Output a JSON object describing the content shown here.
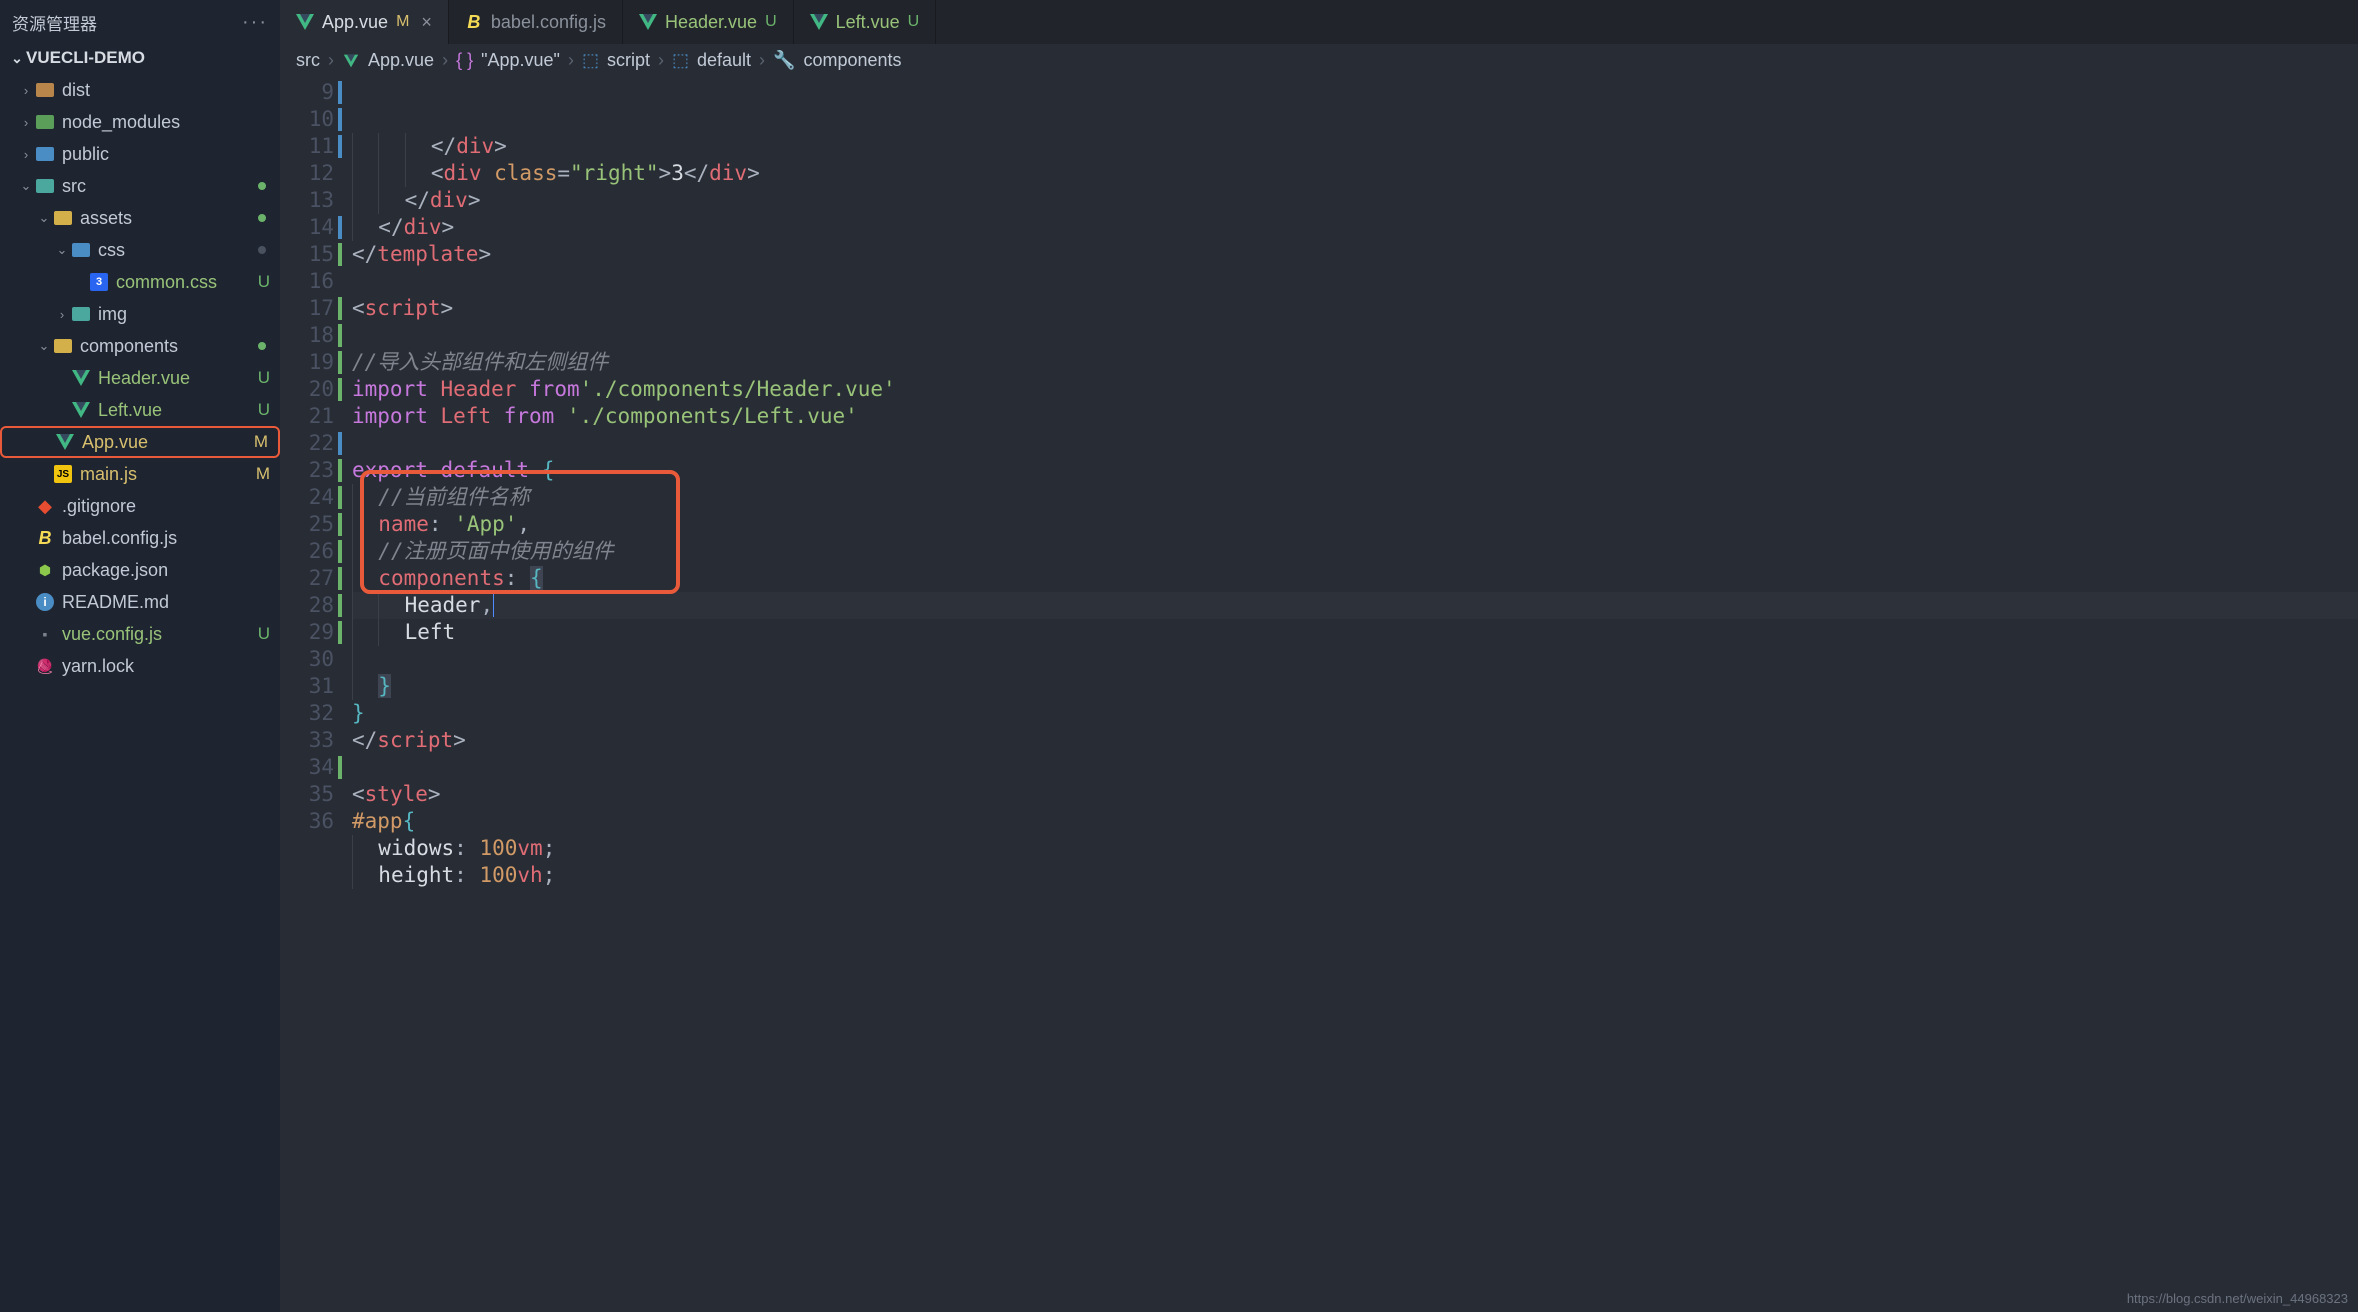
{
  "sidebar": {
    "title": "资源管理器",
    "project": "VUECLI-DEMO",
    "tree": [
      {
        "indent": 1,
        "chevron": "›",
        "icon": "folder",
        "label": "dist",
        "badge": ""
      },
      {
        "indent": 1,
        "chevron": "›",
        "icon": "folder-green",
        "label": "node_modules",
        "badge": ""
      },
      {
        "indent": 1,
        "chevron": "›",
        "icon": "folder-blue",
        "label": "public",
        "badge": ""
      },
      {
        "indent": 1,
        "chevron": "⌄",
        "icon": "folder-teal",
        "label": "src",
        "badge": "dot"
      },
      {
        "indent": 2,
        "chevron": "⌄",
        "icon": "folder-yellow",
        "label": "assets",
        "badge": "dot"
      },
      {
        "indent": 3,
        "chevron": "⌄",
        "icon": "folder-blue",
        "label": "css",
        "badge": "dot-dim"
      },
      {
        "indent": 4,
        "chevron": "",
        "icon": "css",
        "label": "common.css",
        "badge": "U"
      },
      {
        "indent": 3,
        "chevron": "›",
        "icon": "folder-teal",
        "label": "img",
        "badge": ""
      },
      {
        "indent": 2,
        "chevron": "⌄",
        "icon": "folder-yellow",
        "label": "components",
        "badge": "dot"
      },
      {
        "indent": 3,
        "chevron": "",
        "icon": "vue",
        "label": "Header.vue",
        "badge": "U"
      },
      {
        "indent": 3,
        "chevron": "",
        "icon": "vue",
        "label": "Left.vue",
        "badge": "U"
      },
      {
        "indent": 2,
        "chevron": "",
        "icon": "vue",
        "label": "App.vue",
        "badge": "M",
        "highlighted": true
      },
      {
        "indent": 2,
        "chevron": "",
        "icon": "js",
        "label": "main.js",
        "badge": "M"
      },
      {
        "indent": 1,
        "chevron": "",
        "icon": "git",
        "label": ".gitignore",
        "badge": ""
      },
      {
        "indent": 1,
        "chevron": "",
        "icon": "babel",
        "label": "babel.config.js",
        "badge": ""
      },
      {
        "indent": 1,
        "chevron": "",
        "icon": "node",
        "label": "package.json",
        "badge": ""
      },
      {
        "indent": 1,
        "chevron": "",
        "icon": "info",
        "label": "README.md",
        "badge": ""
      },
      {
        "indent": 1,
        "chevron": "",
        "icon": "vueconf",
        "label": "vue.config.js",
        "badge": "U"
      },
      {
        "indent": 1,
        "chevron": "",
        "icon": "yarn",
        "label": "yarn.lock",
        "badge": ""
      }
    ]
  },
  "tabs": [
    {
      "icon": "vue",
      "label": "App.vue",
      "badge": "M",
      "active": true,
      "close": true
    },
    {
      "icon": "babel",
      "label": "babel.config.js",
      "badge": "",
      "active": false
    },
    {
      "icon": "vue",
      "label": "Header.vue",
      "badge": "U",
      "active": false
    },
    {
      "icon": "vue",
      "label": "Left.vue",
      "badge": "U",
      "active": false
    }
  ],
  "breadcrumb": {
    "parts": [
      "src",
      "App.vue",
      "\"App.vue\"",
      "script",
      "default",
      "components"
    ]
  },
  "gutter": {
    "start": 9,
    "end": 36,
    "changed_new": [
      15,
      17,
      18,
      19,
      20,
      23,
      24,
      25,
      26,
      27,
      28,
      29,
      34
    ],
    "changed_mod": [
      9,
      10,
      11,
      14,
      22
    ]
  },
  "code": {
    "lines": [
      {
        "n": 9,
        "segs": [
          [
            "g",
            "      "
          ],
          [
            "p",
            "</"
          ],
          [
            "t",
            "div"
          ],
          [
            "p",
            ">"
          ]
        ]
      },
      {
        "n": 10,
        "segs": [
          [
            "g",
            "      "
          ],
          [
            "p",
            "<"
          ],
          [
            "t",
            "div"
          ],
          [
            "w",
            " "
          ],
          [
            "a",
            "class"
          ],
          [
            "p",
            "="
          ],
          [
            "s",
            "\"right\""
          ],
          [
            "p",
            ">"
          ],
          [
            "w",
            "3"
          ],
          [
            "p",
            "</"
          ],
          [
            "t",
            "div"
          ],
          [
            "p",
            ">"
          ]
        ]
      },
      {
        "n": 11,
        "segs": [
          [
            "g",
            "    "
          ],
          [
            "p",
            "</"
          ],
          [
            "t",
            "div"
          ],
          [
            "p",
            ">"
          ]
        ]
      },
      {
        "n": 12,
        "segs": [
          [
            "g",
            "  "
          ],
          [
            "p",
            "</"
          ],
          [
            "t",
            "div"
          ],
          [
            "p",
            ">"
          ]
        ]
      },
      {
        "n": 13,
        "segs": [
          [
            "p",
            "</"
          ],
          [
            "t",
            "template"
          ],
          [
            "p",
            ">"
          ]
        ]
      },
      {
        "n": 14,
        "segs": []
      },
      {
        "n": 15,
        "segs": [
          [
            "p",
            "<"
          ],
          [
            "t",
            "script"
          ],
          [
            "p",
            ">"
          ]
        ]
      },
      {
        "n": 16,
        "segs": []
      },
      {
        "n": 17,
        "segs": [
          [
            "c",
            "//导入头部组件和左侧组件"
          ]
        ]
      },
      {
        "n": 18,
        "segs": [
          [
            "k",
            "import"
          ],
          [
            "w",
            " "
          ],
          [
            "v",
            "Header"
          ],
          [
            "w",
            " "
          ],
          [
            "k",
            "from"
          ],
          [
            "s",
            "'./components/Header.vue'"
          ]
        ]
      },
      {
        "n": 19,
        "segs": [
          [
            "k",
            "import"
          ],
          [
            "w",
            " "
          ],
          [
            "v",
            "Left"
          ],
          [
            "w",
            " "
          ],
          [
            "k",
            "from"
          ],
          [
            "w",
            " "
          ],
          [
            "s",
            "'./components/Left.vue'"
          ]
        ]
      },
      {
        "n": 20,
        "segs": []
      },
      {
        "n": 21,
        "segs": [
          [
            "k",
            "export"
          ],
          [
            "w",
            " "
          ],
          [
            "k",
            "default"
          ],
          [
            "w",
            " "
          ],
          [
            "b",
            "{"
          ]
        ]
      },
      {
        "n": 22,
        "segs": [
          [
            "g",
            "  "
          ],
          [
            "c",
            "//当前组件名称"
          ]
        ]
      },
      {
        "n": 23,
        "segs": [
          [
            "g",
            "  "
          ],
          [
            "v",
            "name"
          ],
          [
            "p",
            ":"
          ],
          [
            "w",
            " "
          ],
          [
            "s",
            "'App'"
          ],
          [
            "p",
            ","
          ]
        ]
      },
      {
        "n": 24,
        "segs": [
          [
            "g",
            "  "
          ],
          [
            "c",
            "//注册页面中使用的组件"
          ]
        ]
      },
      {
        "n": 25,
        "segs": [
          [
            "g",
            "  "
          ],
          [
            "v",
            "components"
          ],
          [
            "p",
            ":"
          ],
          [
            "w",
            " "
          ],
          [
            "bh",
            "{"
          ]
        ]
      },
      {
        "n": 26,
        "cur": true,
        "segs": [
          [
            "g",
            "    "
          ],
          [
            "w",
            "Header"
          ],
          [
            "p",
            ","
          ],
          [
            "cur",
            ""
          ]
        ]
      },
      {
        "n": 27,
        "segs": [
          [
            "g",
            "    "
          ],
          [
            "w",
            "Left"
          ]
        ]
      },
      {
        "n": 28,
        "segs": [
          [
            "g",
            "  "
          ]
        ]
      },
      {
        "n": 29,
        "segs": [
          [
            "g",
            "  "
          ],
          [
            "bh",
            "}"
          ]
        ]
      },
      {
        "n": 30,
        "segs": [
          [
            "b",
            "}"
          ]
        ]
      },
      {
        "n": 31,
        "segs": [
          [
            "p",
            "</"
          ],
          [
            "t",
            "script"
          ],
          [
            "p",
            ">"
          ]
        ]
      },
      {
        "n": 32,
        "segs": []
      },
      {
        "n": 33,
        "segs": [
          [
            "p",
            "<"
          ],
          [
            "t",
            "style"
          ],
          [
            "p",
            ">"
          ]
        ]
      },
      {
        "n": 34,
        "segs": [
          [
            "sel",
            "#app"
          ],
          [
            "b",
            "{"
          ]
        ]
      },
      {
        "n": 35,
        "segs": [
          [
            "g",
            "  "
          ],
          [
            "w",
            "widows"
          ],
          [
            "p",
            ":"
          ],
          [
            "w",
            " "
          ],
          [
            "n",
            "100"
          ],
          [
            "v",
            "vm"
          ],
          [
            "p",
            ";"
          ]
        ]
      },
      {
        "n": 36,
        "segs": [
          [
            "g",
            "  "
          ],
          [
            "w",
            "height"
          ],
          [
            "p",
            ":"
          ],
          [
            "w",
            " "
          ],
          [
            "n",
            "100"
          ],
          [
            "v",
            "vh"
          ],
          [
            "p",
            ";"
          ]
        ]
      }
    ]
  },
  "watermark": "https://blog.csdn.net/weixin_44968323"
}
